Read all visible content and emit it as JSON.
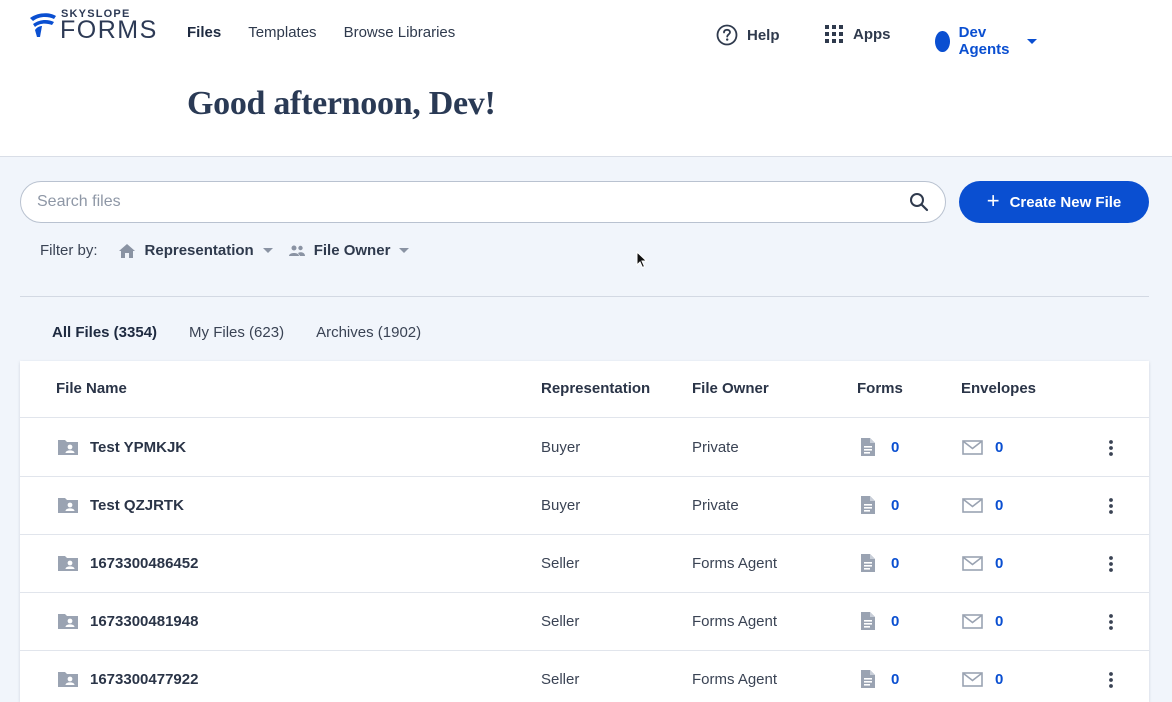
{
  "logo": {
    "top": "SKYSLOPE",
    "main": "FORMS"
  },
  "nav": [
    {
      "label": "Files",
      "active": true
    },
    {
      "label": "Templates",
      "active": false
    },
    {
      "label": "Browse Libraries",
      "active": false
    }
  ],
  "topbar": {
    "help": "Help",
    "apps": "Apps",
    "user": "Dev Agents"
  },
  "greeting": "Good afternoon, Dev!",
  "search": {
    "placeholder": "Search files",
    "value": ""
  },
  "create_button": "Create New File",
  "filter": {
    "label": "Filter by:",
    "representation": "Representation",
    "file_owner": "File Owner"
  },
  "tabs": [
    {
      "label": "All Files (3354)",
      "active": true
    },
    {
      "label": "My Files (623)",
      "active": false
    },
    {
      "label": "Archives (1902)",
      "active": false
    }
  ],
  "table": {
    "columns": [
      "File Name",
      "Representation",
      "File Owner",
      "Forms",
      "Envelopes"
    ],
    "rows": [
      {
        "name": "Test YPMKJK",
        "representation": "Buyer",
        "owner": "Private",
        "forms": "0",
        "envelopes": "0"
      },
      {
        "name": "Test QZJRTK",
        "representation": "Buyer",
        "owner": "Private",
        "forms": "0",
        "envelopes": "0"
      },
      {
        "name": "1673300486452",
        "representation": "Seller",
        "owner": "Forms Agent",
        "forms": "0",
        "envelopes": "0"
      },
      {
        "name": "1673300481948",
        "representation": "Seller",
        "owner": "Forms Agent",
        "forms": "0",
        "envelopes": "0"
      },
      {
        "name": "1673300477922",
        "representation": "Seller",
        "owner": "Forms Agent",
        "forms": "0",
        "envelopes": "0"
      }
    ]
  },
  "colors": {
    "primary": "#0a4fd1",
    "page_bg": "#f1f5fb",
    "text": "#2a3447"
  }
}
